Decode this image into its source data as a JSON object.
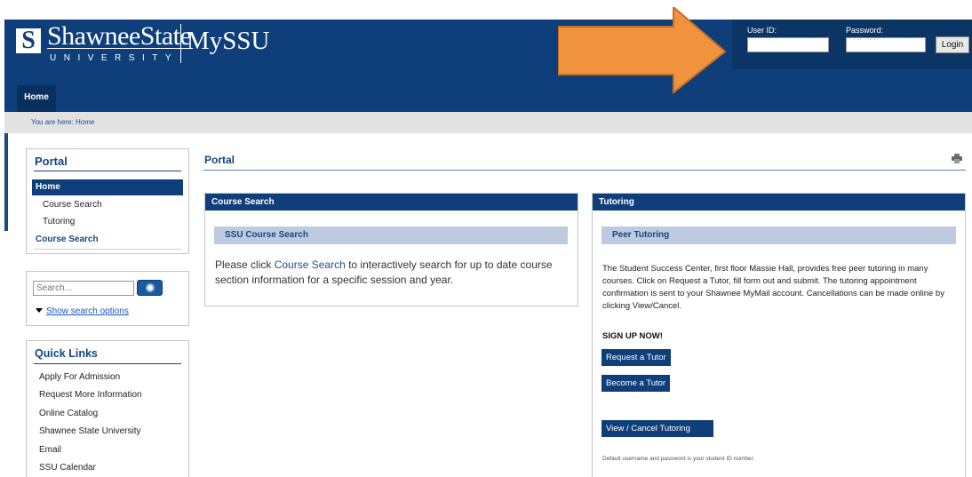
{
  "header": {
    "logo_mark": "S",
    "university_name": "ShawneeState",
    "university_sub": "UNIVERSITY",
    "portal_name": "MySSU",
    "home_tab": "Home"
  },
  "login": {
    "user_id_label": "User ID:",
    "password_label": "Password:",
    "user_id_value": "",
    "password_value": "",
    "login_button": "Login"
  },
  "breadcrumb": {
    "text": "You are here:  Home"
  },
  "sidebar": {
    "portal_title": "Portal",
    "nav_home": "Home",
    "nav_sub_items": [
      "Course Search",
      "Tutoring"
    ],
    "nav_course_search": "Course Search",
    "search_placeholder": "Search...",
    "search_options_link": "Show search options",
    "quick_links_title": "Quick Links",
    "quick_links": [
      "Apply For Admission",
      "Request More Information",
      "Online Catalog",
      "Shawnee State University",
      "Email",
      "SSU Calendar"
    ]
  },
  "main": {
    "title": "Portal",
    "course_search": {
      "header": "Course Search",
      "subheader": "SSU Course Search",
      "text_before": "Please click ",
      "link": "Course Search",
      "text_after": " to interactively search for up to date course section information for a specific session and year."
    },
    "tutoring": {
      "header": "Tutoring",
      "subheader": "Peer Tutoring",
      "description": "The Student Success Center, first floor Massie Hall, provides free peer tutoring in many courses. Click on Request a Tutor, fill form out and submit. The tutoring appointment confirmation is sent to your Shawnee MyMail account. Cancellations can be made online by clicking View/Cancel.",
      "signup": "SIGN UP NOW!",
      "request_button": "Request a Tutor",
      "become_button": "Become a Tutor",
      "view_cancel_button": "View / Cancel Tutoring",
      "note": "Default username and password is your student ID number."
    }
  },
  "colors": {
    "header_blue": "#0f3f7a",
    "arrow_orange": "#f0923e",
    "subheader_blue": "#bccbe0"
  },
  "icons": [
    "print-icon",
    "search-icon",
    "arrow-overlay-icon"
  ]
}
